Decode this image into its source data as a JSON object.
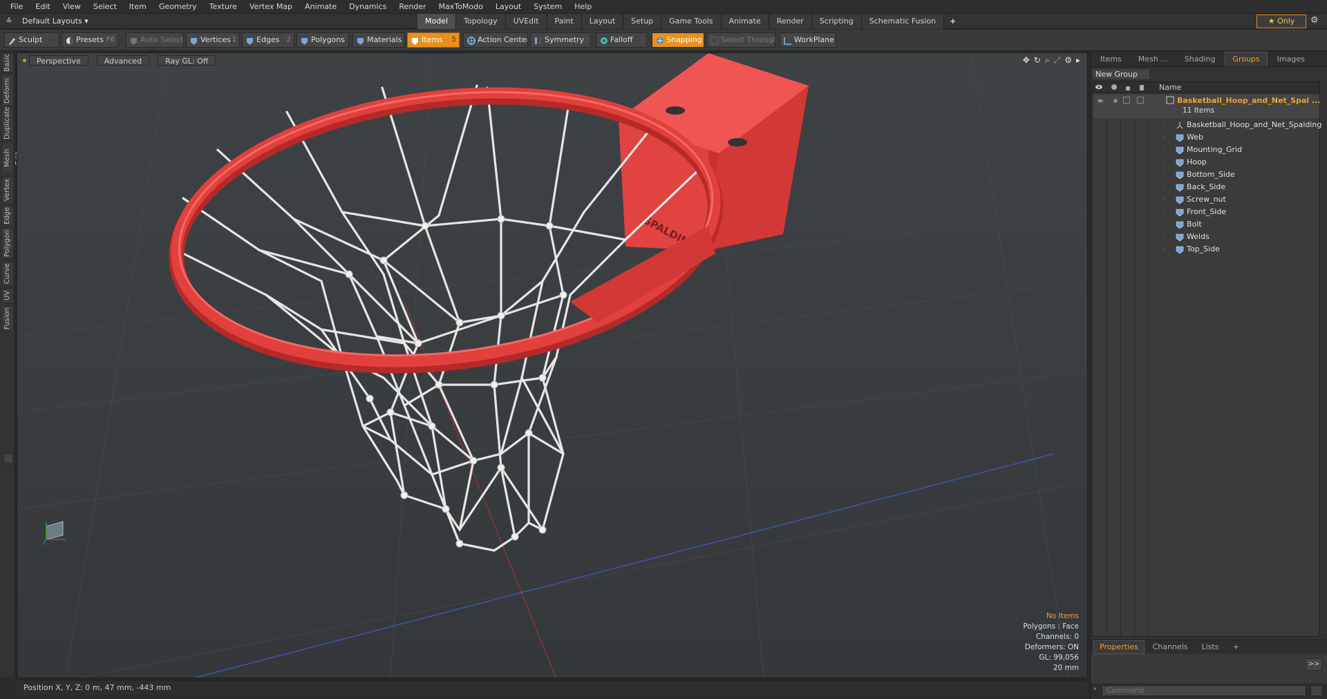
{
  "menu": [
    "File",
    "Edit",
    "View",
    "Select",
    "Item",
    "Geometry",
    "Texture",
    "Vertex Map",
    "Animate",
    "Dynamics",
    "Render",
    "MaxToModo",
    "Layout",
    "System",
    "Help"
  ],
  "layoutbar": {
    "layout_dropdown": "Default Layouts ▾",
    "tabs": [
      "Model",
      "Topology",
      "UVEdit",
      "Paint",
      "Layout",
      "Setup",
      "Game Tools",
      "Animate",
      "Render",
      "Scripting",
      "Schematic Fusion"
    ],
    "active_tab": "Model",
    "add": "+",
    "only_label": "★  Only"
  },
  "toolbar": {
    "sculpt": "Sculpt",
    "presets": "Presets",
    "presets_key": "F6",
    "auto_select": "Auto Select",
    "vertices": "Vertices",
    "vertices_count": "1",
    "edges": "Edges",
    "edges_count": "2",
    "polygons": "Polygons",
    "materials": "Materials",
    "items": "Items",
    "items_count": "5",
    "action_center": "Action Center",
    "symmetry": "Symmetry",
    "falloff": "Falloff",
    "snapping": "Snapping",
    "select_through": "Select Through",
    "workplane": "WorkPlane"
  },
  "left_tabs": [
    "Basic",
    "Deform",
    "Duplicate",
    "Mesh Edit",
    "Vertex",
    "Edge",
    "Polygon",
    "Curve",
    "UV",
    "Fusion"
  ],
  "viewport": {
    "view": "Perspective",
    "advanced": "Advanced",
    "raygl": "Ray GL: Off",
    "stats": {
      "selection": "No Items",
      "polygons": "Polygons : Face",
      "channels": "Channels: 0",
      "deformers": "Deformers: ON",
      "gl": "GL: 99,056",
      "scale": "20 mm"
    },
    "brand_text": "SPALDING"
  },
  "statusbar": {
    "position": "Position X, Y, Z:  0 m, 47 mm, -443 mm"
  },
  "right_panel": {
    "tabs": [
      "Items",
      "Mesh ...",
      "Shading",
      "Groups",
      "Images"
    ],
    "active_tab": "Groups",
    "new_group": "New Group",
    "name_header": "Name",
    "root": {
      "name": "Basketball_Hoop_and_Net_Spal ...",
      "count": "11 Items"
    },
    "items": [
      "Basketball_Hoop_and_Net_Spalding",
      "Web",
      "Mounting_Grid",
      "Hoop",
      "Bottom_Side",
      "Back_Side",
      "Screw_nut",
      "Front_Side",
      "Bolt",
      "Welds",
      "Top_Side"
    ],
    "bottom_tabs": [
      "Properties",
      "Channels",
      "Lists"
    ],
    "bottom_active": "Properties",
    "expand": ">>",
    "command_placeholder": "Command"
  },
  "colors": {
    "accent": "#e8901c",
    "hoop_red": "#e2403c",
    "net_white": "#e6e6e6"
  }
}
